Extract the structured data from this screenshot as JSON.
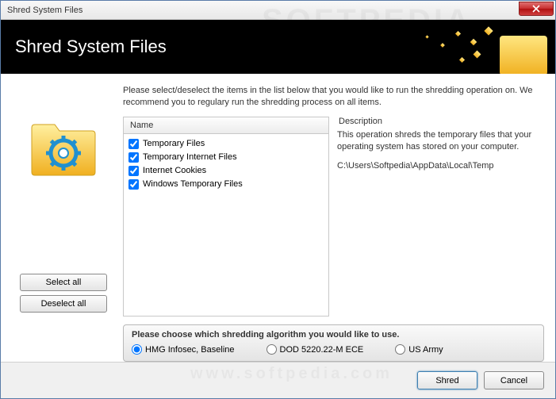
{
  "window": {
    "title": "Shred System Files"
  },
  "header": {
    "title": "Shred System Files"
  },
  "instruction": "Please select/deselect the items in the list below that you would like to run the shredding operation on. We recommend you to regulary run the shredding process on all items.",
  "list": {
    "column_header": "Name",
    "items": [
      {
        "label": "Temporary Files",
        "checked": true
      },
      {
        "label": "Temporary Internet Files",
        "checked": true
      },
      {
        "label": "Internet Cookies",
        "checked": true
      },
      {
        "label": "Windows Temporary Files",
        "checked": true
      }
    ]
  },
  "buttons": {
    "select_all": "Select all",
    "deselect_all": "Deselect all",
    "shred": "Shred",
    "cancel": "Cancel"
  },
  "description": {
    "label": "Description",
    "body": "This operation shreds the temporary files that your operating system has stored on your computer.",
    "path": "C:\\Users\\Softpedia\\AppData\\Local\\Temp"
  },
  "algorithm": {
    "title": "Please choose which shredding algorithm you would like to use.",
    "options": [
      {
        "label": "HMG Infosec, Baseline",
        "selected": true
      },
      {
        "label": "DOD 5220.22-M ECE",
        "selected": false
      },
      {
        "label": "US Army",
        "selected": false
      }
    ]
  }
}
